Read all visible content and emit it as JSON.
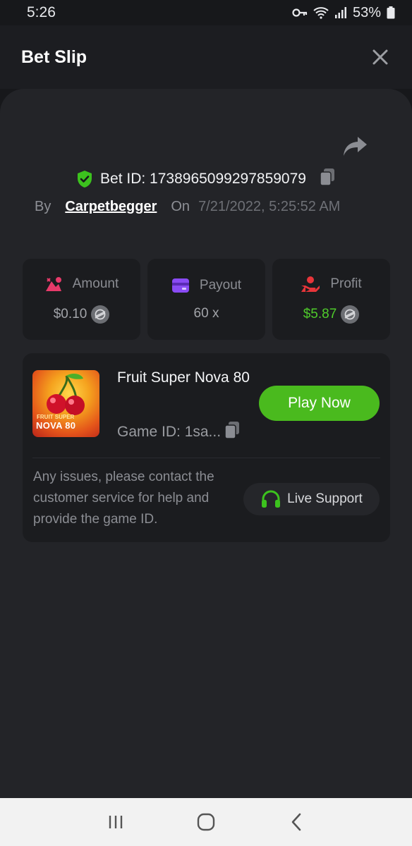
{
  "status_bar": {
    "time": "5:26",
    "battery": "53%",
    "icons": [
      "key-icon",
      "wifi-icon",
      "signal-icon",
      "battery-icon"
    ]
  },
  "header": {
    "title": "Bet Slip",
    "close_icon": "close-icon"
  },
  "bet": {
    "id_label": "Bet ID: 1738965099297859079",
    "by_label": "By",
    "user": "Carpetbegger",
    "on_label": "On",
    "date": "7/21/2022, 5:25:52 AM"
  },
  "stats": {
    "amount": {
      "label": "Amount",
      "value": "$0.10",
      "icon": "amount-icon"
    },
    "payout": {
      "label": "Payout",
      "value": "60 x",
      "icon": "card-icon"
    },
    "profit": {
      "label": "Profit",
      "value": "$5.87",
      "icon": "profit-hand-icon"
    }
  },
  "game": {
    "title": "Fruit Super Nova 80",
    "game_id": "Game ID: 1sa...",
    "thumb_line1": "FRUIT SUPER",
    "thumb_line2": "NOVA 80",
    "play_label": "Play Now",
    "issues_text": "Any issues, please contact the customer service for help and provide the game ID.",
    "support_label": "Live Support"
  },
  "colors": {
    "accent_green": "#4aba1e",
    "profit_green": "#4fcb2b",
    "background": "#17181b",
    "sheet": "#232428",
    "card": "#1b1c1f"
  }
}
